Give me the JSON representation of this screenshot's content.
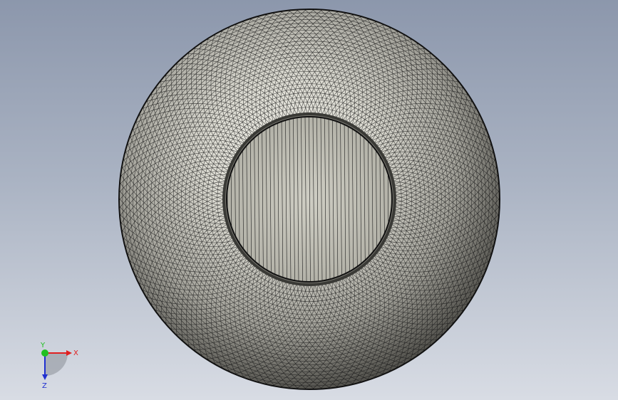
{
  "viewport": {
    "background_top": "#8c97ac",
    "background_bottom": "#d8dce4",
    "mesh_line_color": "#1a1a1a",
    "shell_light": "#ecebe4",
    "shell_mid": "#b5b4ac",
    "shell_dark": "#55544e",
    "inner_face": "#c8c7bd"
  },
  "triad": {
    "x_label": "X",
    "y_label": "Y",
    "z_label": "Z",
    "x_color": "#e02020",
    "y_color": "#20c020",
    "z_color": "#2030d0"
  }
}
